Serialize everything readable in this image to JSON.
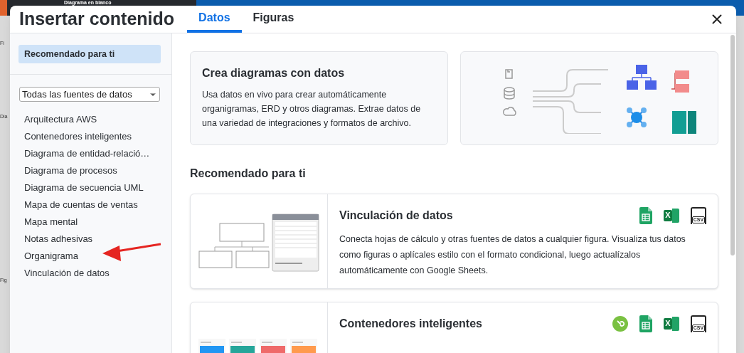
{
  "background": {
    "title": "Diagrama en blanco",
    "side_labels": [
      "Fi",
      "Dia",
      "Fig"
    ]
  },
  "dialog": {
    "title": "Insertar contenido",
    "tabs": [
      {
        "label": "Datos",
        "selected": true
      },
      {
        "label": "Figuras",
        "selected": false
      }
    ]
  },
  "sidebar": {
    "featured": {
      "label": "Recomendado para ti",
      "selected": true
    },
    "filter": {
      "value": "Todas las fuentes de datos"
    },
    "items": [
      {
        "label": "Arquitectura AWS",
        "selected": false,
        "annotated": false
      },
      {
        "label": "Contenedores inteligentes",
        "selected": false,
        "annotated": false
      },
      {
        "label": "Diagrama de entidad-relació…",
        "selected": false,
        "annotated": false
      },
      {
        "label": "Diagrama de procesos",
        "selected": false,
        "annotated": false
      },
      {
        "label": "Diagrama de secuencia UML",
        "selected": false,
        "annotated": false
      },
      {
        "label": "Mapa de cuentas de ventas",
        "selected": false,
        "annotated": false
      },
      {
        "label": "Mapa mental",
        "selected": false,
        "annotated": false
      },
      {
        "label": "Notas adhesivas",
        "selected": false,
        "annotated": false
      },
      {
        "label": "Organigrama",
        "selected": false,
        "annotated": true
      },
      {
        "label": "Vinculación de datos",
        "selected": false,
        "annotated": false
      }
    ]
  },
  "hero": {
    "title": "Crea diagramas con datos",
    "description": "Usa datos en vivo para crear automáticamente organigramas, ERD y otros diagramas. Extrae datos de una variedad de integraciones y formatos de archivo."
  },
  "section_title": "Recomendado para ti",
  "cards": [
    {
      "title": "Vinculación de datos",
      "kind": "table",
      "description": "Conecta hojas de cálculo y otras fuentes de datos a cualquier figura. Visualiza tus datos como figuras o aplícales estilo con el formato condicional, luego actualízalos automáticamente con Google Sheets.",
      "formats": [
        {
          "kind": "sheets"
        },
        {
          "kind": "excel",
          "label": "X"
        },
        {
          "kind": "csv",
          "label": "CSV"
        }
      ]
    },
    {
      "title": "Contenedores inteligentes",
      "kind": "kanban",
      "formats": [
        {
          "kind": "link"
        },
        {
          "kind": "sheets"
        },
        {
          "kind": "excel",
          "label": "X"
        },
        {
          "kind": "csv",
          "label": "CSV"
        }
      ]
    }
  ]
}
